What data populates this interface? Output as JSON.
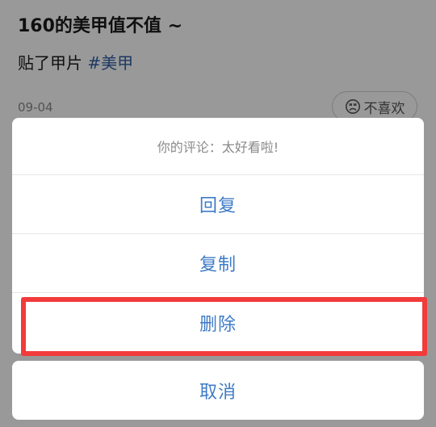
{
  "post": {
    "title": "160的美甲值不值 ~",
    "body_text": "贴了甲片 ",
    "hashtag": "#美甲",
    "date": "09-04",
    "dislike_label": "不喜欢"
  },
  "sheet": {
    "header": "你的评论：太好看啦!",
    "options": [
      {
        "label": "回复"
      },
      {
        "label": "复制"
      },
      {
        "label": "删除"
      }
    ],
    "cancel_label": "取消"
  },
  "colors": {
    "accent": "#3e7bc7",
    "hashtag": "#2f5fa3",
    "highlight": "#f23b3b",
    "overlay": "rgba(0,0,0,0.40)"
  },
  "icons": {
    "dislike": "sad-face-icon"
  }
}
